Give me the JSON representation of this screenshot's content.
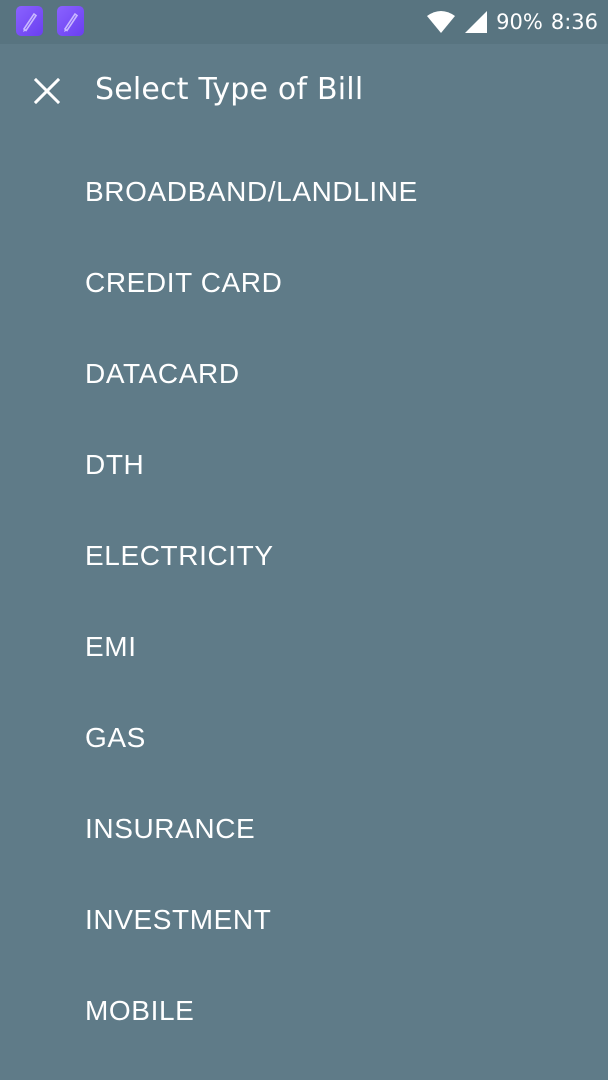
{
  "status_bar": {
    "notification_icons": [
      "pen-app-icon",
      "pen-app-icon"
    ],
    "battery": "90%",
    "time": "8:36"
  },
  "header": {
    "title": "Select Type of Bill"
  },
  "bill_types": [
    "BROADBAND/LANDLINE",
    "CREDIT CARD",
    "DATACARD",
    "DTH",
    "ELECTRICITY",
    "EMI",
    "GAS",
    "INSURANCE",
    "INVESTMENT",
    "MOBILE"
  ],
  "colors": {
    "background": "#5f7b88",
    "status_bar": "#587480",
    "text": "#ffffff",
    "app_icon": "#7a50f8"
  }
}
